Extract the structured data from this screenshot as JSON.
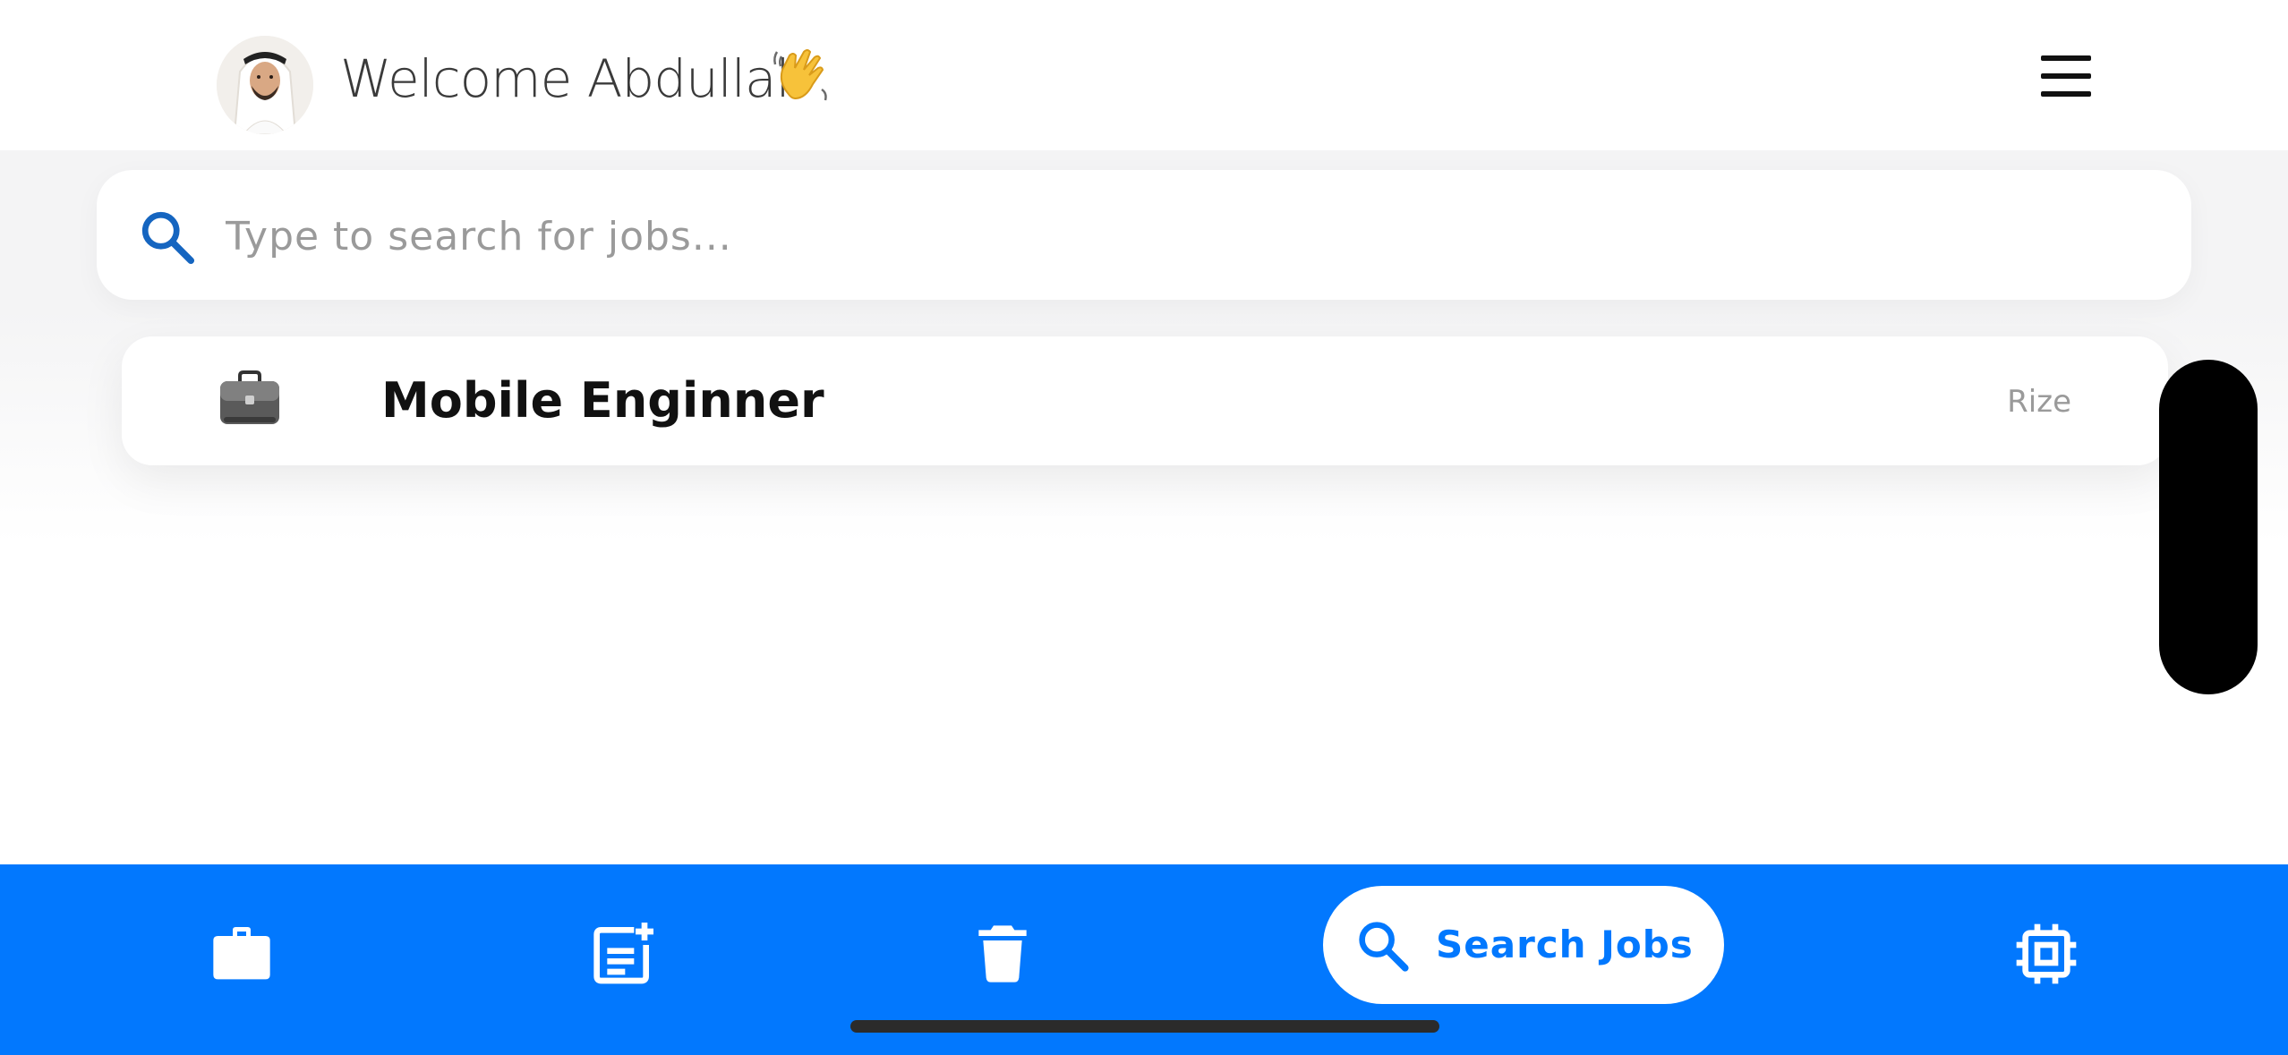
{
  "header": {
    "welcome_text": "Welcome Abdullah",
    "avatar_icon": "user-avatar",
    "wave_icon": "waving-hand-icon",
    "menu_icon": "hamburger-menu-icon"
  },
  "search": {
    "placeholder": "Type to search for jobs...",
    "value": "",
    "icon": "search-icon"
  },
  "jobs": [
    {
      "title": "Mobile Enginner",
      "company": "Rize",
      "icon": "briefcase-icon"
    }
  ],
  "bottom_nav": {
    "items": [
      {
        "icon": "briefcase-icon",
        "label": ""
      },
      {
        "icon": "add-post-icon",
        "label": ""
      },
      {
        "icon": "trash-icon",
        "label": ""
      },
      {
        "icon": "search-icon",
        "label": "Search Jobs",
        "active": true
      },
      {
        "icon": "chip-icon",
        "label": ""
      }
    ]
  },
  "colors": {
    "accent": "#0278fe",
    "text_primary": "#111111",
    "text_muted": "#9a9a9a",
    "search_icon": "#1565c0"
  }
}
